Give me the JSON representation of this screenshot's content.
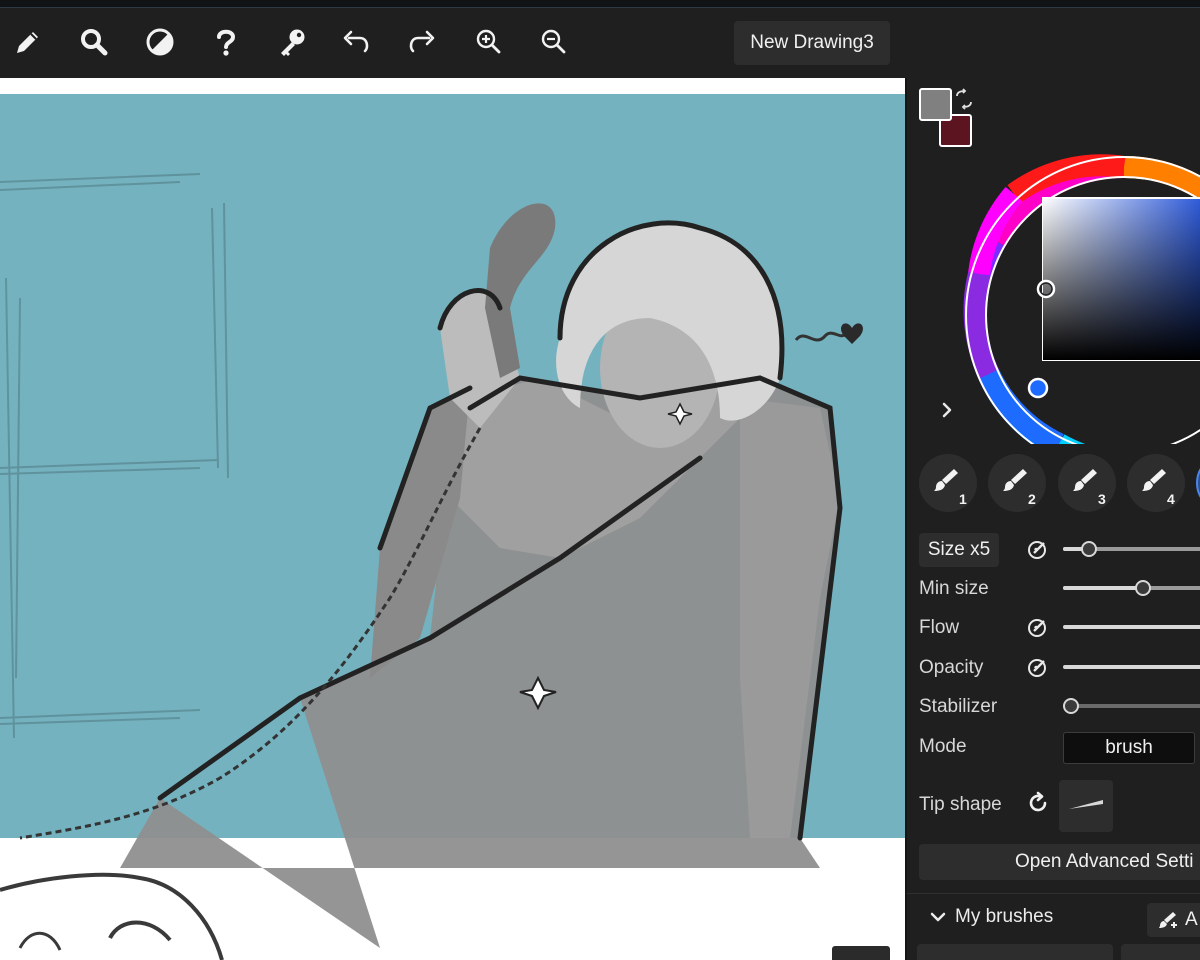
{
  "toolbar": {
    "tools": [
      {
        "name": "pencil-icon"
      },
      {
        "name": "search-icon"
      },
      {
        "name": "contrast-icon"
      },
      {
        "name": "help-icon"
      },
      {
        "name": "key-icon"
      },
      {
        "name": "undo-icon"
      },
      {
        "name": "redo-icon"
      },
      {
        "name": "zoom-in-icon"
      },
      {
        "name": "zoom-out-icon"
      }
    ],
    "document_title": "New Drawing3"
  },
  "colors": {
    "primary": "#808080",
    "secondary": "#5c1420",
    "canvas_background": "#74b2bf",
    "panel_background": "#1f1f1f"
  },
  "brush_presets": [
    {
      "label": "1"
    },
    {
      "label": "2"
    },
    {
      "label": "3"
    },
    {
      "label": "4"
    }
  ],
  "brush_settings": {
    "size_label": "Size x5",
    "min_size_label": "Min size",
    "flow_label": "Flow",
    "opacity_label": "Opacity",
    "stabilizer_label": "Stabilizer",
    "mode_label": "Mode",
    "mode_value": "brush",
    "tip_shape_label": "Tip shape"
  },
  "advanced_button": "Open Advanced Setti",
  "my_brushes": {
    "title": "My brushes",
    "add_label": "A"
  }
}
